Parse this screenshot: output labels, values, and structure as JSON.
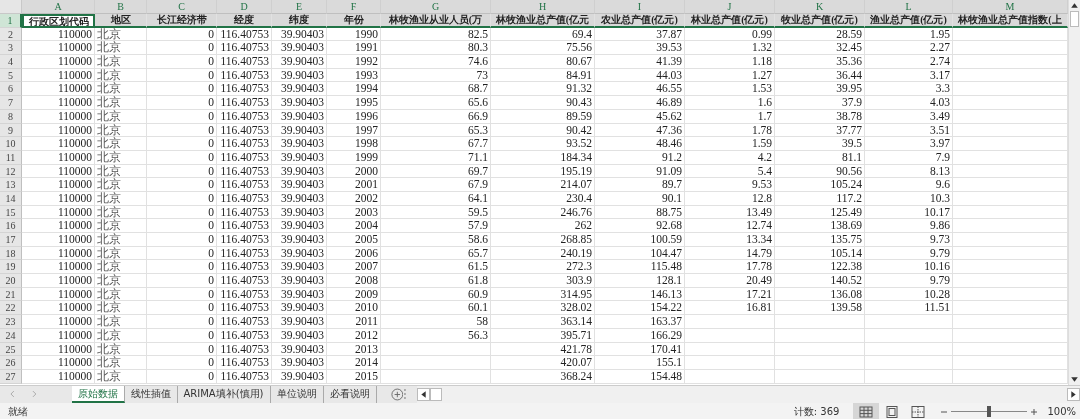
{
  "columns": [
    {
      "letter": "A",
      "header": "行政区划代码",
      "kind": "number"
    },
    {
      "letter": "B",
      "header": "地区",
      "kind": "text"
    },
    {
      "letter": "C",
      "header": "长江经济带",
      "kind": "number"
    },
    {
      "letter": "D",
      "header": "经度",
      "kind": "number"
    },
    {
      "letter": "E",
      "header": "纬度",
      "kind": "number"
    },
    {
      "letter": "F",
      "header": "年份",
      "kind": "number"
    },
    {
      "letter": "G",
      "header": "林牧渔业从业人员(万",
      "kind": "number"
    },
    {
      "letter": "H",
      "header": "林牧渔业总产值(亿元",
      "kind": "number"
    },
    {
      "letter": "I",
      "header": "农业总产值(亿元)",
      "kind": "number"
    },
    {
      "letter": "J",
      "header": "林业总产值(亿元)",
      "kind": "number"
    },
    {
      "letter": "K",
      "header": "牧业总产值(亿元)",
      "kind": "number"
    },
    {
      "letter": "L",
      "header": "渔业总产值(亿元)",
      "kind": "number"
    },
    {
      "letter": "M",
      "header": "林牧渔业总产值指数(上",
      "kind": "number"
    }
  ],
  "header_row": {
    "number": "1",
    "selected": true
  },
  "rows": [
    {
      "number": "2",
      "cells": [
        "110000",
        "北京",
        "0",
        "116.40753",
        "39.90403",
        "1990",
        "82.5",
        "69.4",
        "37.87",
        "0.99",
        "28.59",
        "1.95",
        null
      ]
    },
    {
      "number": "3",
      "cells": [
        "110000",
        "北京",
        "0",
        "116.40753",
        "39.90403",
        "1991",
        "80.3",
        "75.56",
        "39.53",
        "1.32",
        "32.45",
        "2.27",
        null
      ]
    },
    {
      "number": "4",
      "cells": [
        "110000",
        "北京",
        "0",
        "116.40753",
        "39.90403",
        "1992",
        "74.6",
        "80.67",
        "41.39",
        "1.18",
        "35.36",
        "2.74",
        null
      ]
    },
    {
      "number": "5",
      "cells": [
        "110000",
        "北京",
        "0",
        "116.40753",
        "39.90403",
        "1993",
        "73",
        "84.91",
        "44.03",
        "1.27",
        "36.44",
        "3.17",
        null
      ]
    },
    {
      "number": "6",
      "cells": [
        "110000",
        "北京",
        "0",
        "116.40753",
        "39.90403",
        "1994",
        "68.7",
        "91.32",
        "46.55",
        "1.53",
        "39.95",
        "3.3",
        null
      ]
    },
    {
      "number": "7",
      "cells": [
        "110000",
        "北京",
        "0",
        "116.40753",
        "39.90403",
        "1995",
        "65.6",
        "90.43",
        "46.89",
        "1.6",
        "37.9",
        "4.03",
        null
      ]
    },
    {
      "number": "8",
      "cells": [
        "110000",
        "北京",
        "0",
        "116.40753",
        "39.90403",
        "1996",
        "66.9",
        "89.59",
        "45.62",
        "1.7",
        "38.78",
        "3.49",
        null
      ]
    },
    {
      "number": "9",
      "cells": [
        "110000",
        "北京",
        "0",
        "116.40753",
        "39.90403",
        "1997",
        "65.3",
        "90.42",
        "47.36",
        "1.78",
        "37.77",
        "3.51",
        null
      ]
    },
    {
      "number": "10",
      "cells": [
        "110000",
        "北京",
        "0",
        "116.40753",
        "39.90403",
        "1998",
        "67.7",
        "93.52",
        "48.46",
        "1.59",
        "39.5",
        "3.97",
        null
      ]
    },
    {
      "number": "11",
      "cells": [
        "110000",
        "北京",
        "0",
        "116.40753",
        "39.90403",
        "1999",
        "71.1",
        "184.34",
        "91.2",
        "4.2",
        "81.1",
        "7.9",
        null
      ]
    },
    {
      "number": "12",
      "cells": [
        "110000",
        "北京",
        "0",
        "116.40753",
        "39.90403",
        "2000",
        "69.7",
        "195.19",
        "91.09",
        "5.4",
        "90.56",
        "8.13",
        null
      ]
    },
    {
      "number": "13",
      "cells": [
        "110000",
        "北京",
        "0",
        "116.40753",
        "39.90403",
        "2001",
        "67.9",
        "214.07",
        "89.7",
        "9.53",
        "105.24",
        "9.6",
        null
      ]
    },
    {
      "number": "14",
      "cells": [
        "110000",
        "北京",
        "0",
        "116.40753",
        "39.90403",
        "2002",
        "64.1",
        "230.4",
        "90.1",
        "12.8",
        "117.2",
        "10.3",
        null
      ]
    },
    {
      "number": "15",
      "cells": [
        "110000",
        "北京",
        "0",
        "116.40753",
        "39.90403",
        "2003",
        "59.5",
        "246.76",
        "88.75",
        "13.49",
        "125.49",
        "10.17",
        null
      ]
    },
    {
      "number": "16",
      "cells": [
        "110000",
        "北京",
        "0",
        "116.40753",
        "39.90403",
        "2004",
        "57.9",
        "262",
        "92.68",
        "12.74",
        "138.69",
        "9.86",
        null
      ]
    },
    {
      "number": "17",
      "cells": [
        "110000",
        "北京",
        "0",
        "116.40753",
        "39.90403",
        "2005",
        "58.6",
        "268.85",
        "100.59",
        "13.34",
        "135.75",
        "9.73",
        null
      ]
    },
    {
      "number": "18",
      "cells": [
        "110000",
        "北京",
        "0",
        "116.40753",
        "39.90403",
        "2006",
        "65.7",
        "240.19",
        "104.47",
        "14.79",
        "105.14",
        "9.79",
        null
      ]
    },
    {
      "number": "19",
      "cells": [
        "110000",
        "北京",
        "0",
        "116.40753",
        "39.90403",
        "2007",
        "61.5",
        "272.3",
        "115.48",
        "17.78",
        "122.38",
        "10.16",
        null
      ]
    },
    {
      "number": "20",
      "cells": [
        "110000",
        "北京",
        "0",
        "116.40753",
        "39.90403",
        "2008",
        "61.8",
        "303.9",
        "128.1",
        "20.49",
        "140.52",
        "9.79",
        null
      ]
    },
    {
      "number": "21",
      "cells": [
        "110000",
        "北京",
        "0",
        "116.40753",
        "39.90403",
        "2009",
        "60.9",
        "314.95",
        "146.13",
        "17.21",
        "136.08",
        "10.28",
        null
      ]
    },
    {
      "number": "22",
      "cells": [
        "110000",
        "北京",
        "0",
        "116.40753",
        "39.90403",
        "2010",
        "60.1",
        "328.02",
        "154.22",
        "16.81",
        "139.58",
        "11.51",
        null
      ]
    },
    {
      "number": "23",
      "cells": [
        "110000",
        "北京",
        "0",
        "116.40753",
        "39.90403",
        "2011",
        "58",
        "363.14",
        "163.37",
        null,
        null,
        null,
        null
      ]
    },
    {
      "number": "24",
      "cells": [
        "110000",
        "北京",
        "0",
        "116.40753",
        "39.90403",
        "2012",
        "56.3",
        "395.71",
        "166.29",
        null,
        null,
        null,
        null
      ]
    },
    {
      "number": "25",
      "cells": [
        "110000",
        "北京",
        "0",
        "116.40753",
        "39.90403",
        "2013",
        null,
        "421.78",
        "170.41",
        null,
        null,
        null,
        null
      ]
    },
    {
      "number": "26",
      "cells": [
        "110000",
        "北京",
        "0",
        "116.40753",
        "39.90403",
        "2014",
        null,
        "420.07",
        "155.1",
        null,
        null,
        null,
        null
      ]
    },
    {
      "number": "27",
      "cells": [
        "110000",
        "北京",
        "0",
        "116.40753",
        "39.90403",
        "2015",
        null,
        "368.24",
        "154.48",
        null,
        null,
        null,
        null
      ]
    }
  ],
  "sheet_tabs": [
    {
      "label": "原始数据",
      "selected": true
    },
    {
      "label": "线性插值",
      "selected": false
    },
    {
      "label": "ARIMA填补(慎用)",
      "selected": false
    },
    {
      "label": "单位说明",
      "selected": false
    },
    {
      "label": "必看说明",
      "selected": false
    }
  ],
  "status_bar": {
    "status": "就绪",
    "count": "计数: 369",
    "views": [
      {
        "kind": "normal",
        "selected": true
      },
      {
        "kind": "page_layout",
        "selected": false
      },
      {
        "kind": "page_break",
        "selected": false
      }
    ],
    "zoom": {
      "level": 0.5,
      "reading": "100%"
    }
  }
}
